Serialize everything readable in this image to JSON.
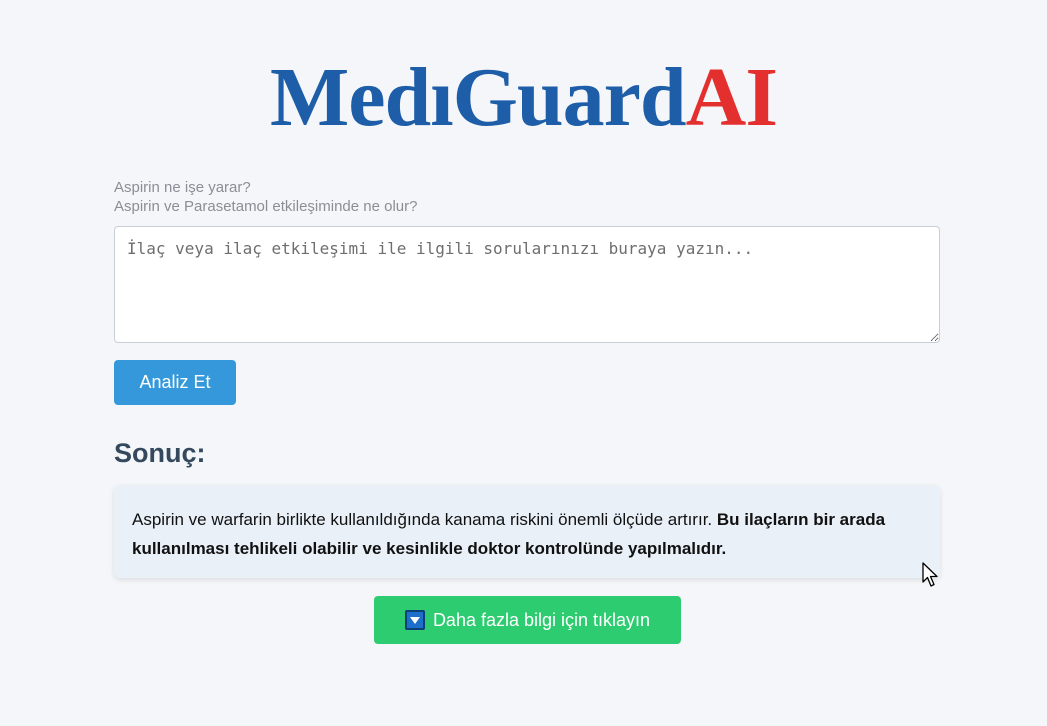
{
  "logo": {
    "part1": "MedıGuard",
    "part2": "AI"
  },
  "examples": [
    "Aspirin ne işe yarar?",
    "Aspirin ve Parasetamol etkileşiminde ne olur?"
  ],
  "query": {
    "value": "",
    "placeholder": "İlaç veya ilaç etkileşimi ile ilgili sorularınızı buraya yazın..."
  },
  "analyze_button": {
    "label": "Analiz Et"
  },
  "result": {
    "heading": "Sonuç:",
    "text_plain": "Aspirin ve warfarin birlikte kullanıldığında kanama riskini önemli ölçüde artırır. ",
    "text_bold": "Bu ilaçların bir arada kullanılması tehlikeli olabilir ve kesinlikle doktor kontrolünde yapılmalıdır."
  },
  "more_button": {
    "icon": "down-arrow-square-icon",
    "label": "Daha fazla bilgi için tıklayın"
  },
  "colors": {
    "logo_primary": "#1e5ea8",
    "logo_accent": "#e3302f",
    "analyze_button": "#3498db",
    "more_button": "#2ecc71",
    "result_background": "#e9f0f8",
    "heading": "#34495e"
  }
}
